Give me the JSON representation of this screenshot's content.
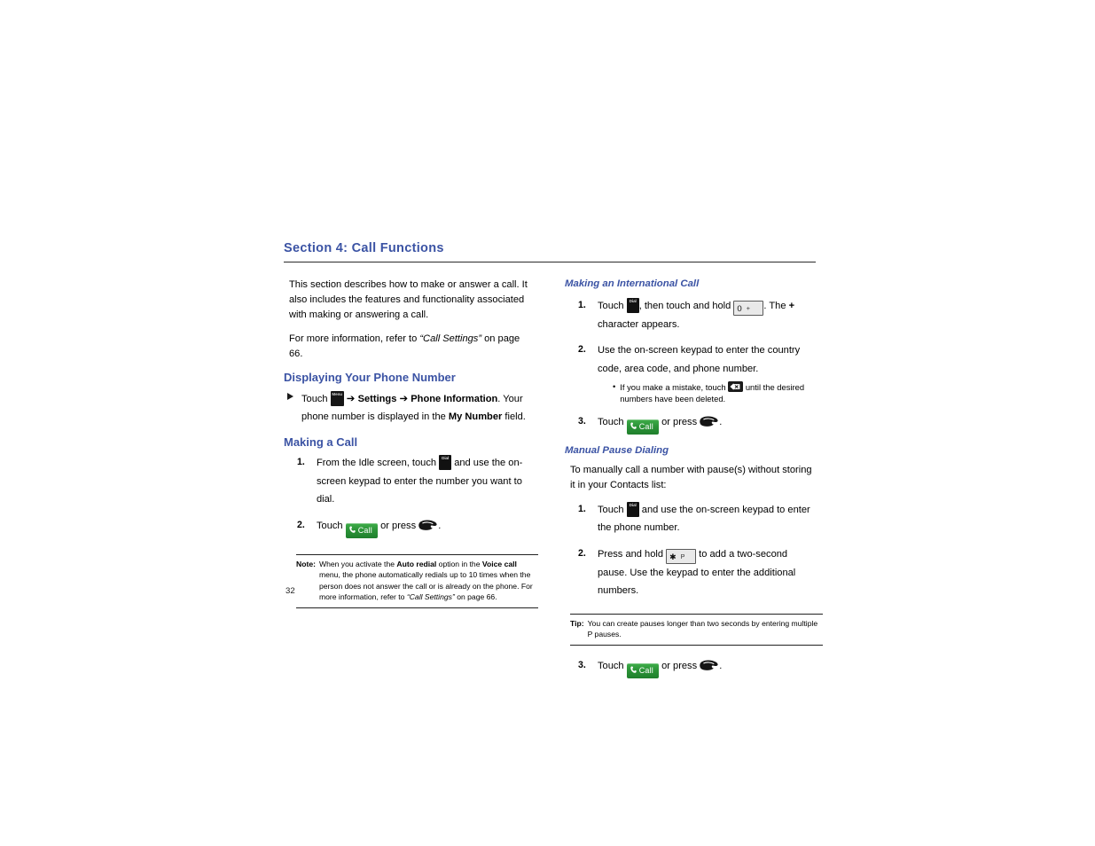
{
  "document": {
    "section_title": "Section 4: Call Functions",
    "page_number": "32"
  },
  "left_column": {
    "intro_paragraph": "This section describes how to make or answer a call. It also includes the features and functionality associated with making or answering a call.",
    "more_info": {
      "prefix": "For more information, refer to ",
      "reference": "“Call Settings”",
      "suffix": " on page 66."
    },
    "displaying_heading": "Displaying Your Phone Number",
    "displaying_step": {
      "touch_label": "Touch",
      "menu_icon": "menu-key-icon",
      "arrow1": "➔",
      "settings_label": "Settings",
      "arrow2": "➔",
      "phone_info_label": "Phone Information",
      "text_after": ". Your phone number is displayed in the ",
      "my_number_label": "My Number",
      "text_end": " field."
    },
    "making_call_heading": "Making a Call",
    "making_call_steps": [
      {
        "number": "1.",
        "text_before": "From the Idle screen, touch ",
        "icon": "dial-key-icon",
        "text_after": " and use the on-screen keypad to enter the number you want to dial."
      },
      {
        "number": "2.",
        "text_before": "Touch ",
        "icon": "call-button-icon",
        "call_label": "Call",
        "text_middle": " or press ",
        "icon2": "send-key-icon",
        "text_after": "."
      }
    ],
    "note": {
      "label": "Note:",
      "part1": "When you activate the ",
      "bold1": "Auto redial",
      "part2": " option in the ",
      "bold2": "Voice call",
      "part3": " menu, the phone automatically redials up to 10 times when the person does not answer the call or is already on the phone. For more information, refer to ",
      "italic1": "“Call Settings”",
      "part4": " on page 66."
    }
  },
  "right_column": {
    "international_heading": "Making an International Call",
    "international_steps": [
      {
        "number": "1.",
        "text_before": "Touch ",
        "icon": "dial-key-icon",
        "text_middle": ", then touch and hold ",
        "key_main": "0",
        "key_sub": "+",
        "text_after_a": ". The ",
        "plus_char": "+",
        "text_after_b": " character appears."
      },
      {
        "number": "2.",
        "text": "Use the on-screen keypad to enter the country code, area code, and phone number.",
        "subbullet": {
          "dot": "•",
          "text_before": "If you make a mistake, touch ",
          "icon": "backspace-key-icon",
          "text_after": " until the desired numbers have been deleted."
        }
      },
      {
        "number": "3.",
        "text_before": "Touch ",
        "icon": "call-button-icon",
        "call_label": "Call",
        "text_middle": " or press ",
        "icon2": "send-key-icon",
        "text_after": "."
      }
    ],
    "manual_pause_heading": "Manual Pause Dialing",
    "manual_pause_intro": "To manually call a number with pause(s) without storing it in your Contacts list:",
    "manual_pause_steps": [
      {
        "number": "1.",
        "text_before": "Touch ",
        "icon": "dial-key-icon",
        "text_after": " and use the on-screen keypad to enter the phone number."
      },
      {
        "number": "2.",
        "text_before": "Press and hold ",
        "key_main": "✱",
        "key_sub": "P",
        "text_after": " to add a two-second pause. Use the keypad to enter the additional numbers."
      }
    ],
    "tip": {
      "label": "Tip:",
      "text": "You can create pauses longer than two seconds by entering multiple P pauses."
    },
    "final_step": {
      "number": "3.",
      "text_before": "Touch ",
      "icon": "call-button-icon",
      "call_label": "Call",
      "text_middle": " or press ",
      "icon2": "send-key-icon",
      "text_after": "."
    }
  },
  "colors": {
    "heading_blue": "#3b53a4",
    "call_button_green": "#2c9438",
    "rule_dark": "#2b2b2b"
  }
}
